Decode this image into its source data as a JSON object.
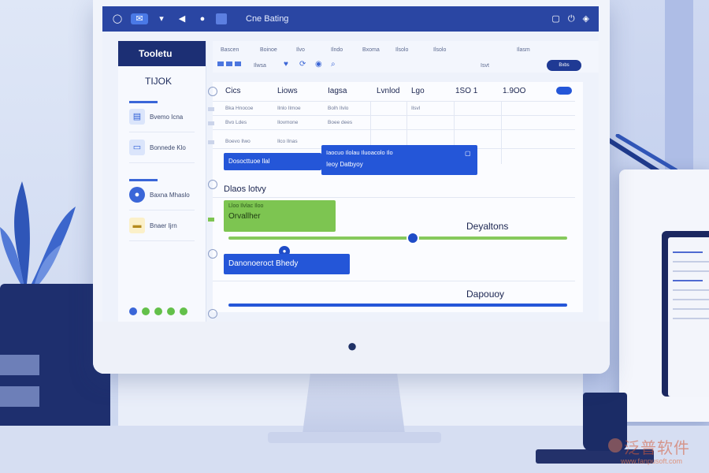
{
  "titlebar": {
    "app_title": "Cne Bating",
    "icons": [
      "ring-icon",
      "message-icon",
      "chevron-down-icon",
      "play-icon",
      "dot-icon",
      "square-icon"
    ],
    "right_icons": [
      "window-icon",
      "power-icon",
      "shield-icon"
    ]
  },
  "sidebar": {
    "header": "Tooletu",
    "subtitle": "TIJOK",
    "items": [
      {
        "label": "Bvemo Icna",
        "icon": "doc-icon"
      },
      {
        "label": "Bonnede Klo",
        "icon": "inbox-icon"
      },
      {
        "label": "Baxna Mhaslo",
        "icon": "user-circle-icon"
      },
      {
        "label": "Bnaer Ijrn",
        "icon": "card-icon"
      }
    ],
    "status_dots": 5
  },
  "toolbar": {
    "labels": [
      "Bascen",
      "Boinoe",
      "Ilvo",
      "Ilndo",
      "Bxoma",
      "Ilsolo",
      "Ilsolo",
      "Ilasm"
    ],
    "tiny_labels": [
      "Ilwsa",
      "Isvt"
    ],
    "action_button": "Bxbs"
  },
  "table": {
    "headers": [
      "Cics",
      "Liows",
      "Iagsa",
      "Lvnlod",
      "Lgo",
      "1SO 1",
      "1.9OO"
    ],
    "rows": [
      [
        "Bka Hnocoe",
        "Ilnlo Ilmoe",
        "Bolh Ilvlo",
        "",
        "Ilsvl",
        "",
        ""
      ],
      [
        "Bvo Ldes",
        "Ilovmone",
        "Boee dees",
        "",
        "",
        "",
        ""
      ],
      [
        "Boevo Ilwo",
        "Ilco Ilnas",
        "",
        "",
        "",
        "",
        ""
      ]
    ],
    "bar_task_1": "Dosocttuoe llal",
    "bar_task_2_line1": "Iaocuo Ilolau Iluoacolo Ilo",
    "bar_task_2_line2": "Ieoy Datbyoy",
    "section_label": "Dlaos lotvy",
    "green_task_line1": "Lloo Ilvlac Iloo",
    "green_task_line2": "Orvallher",
    "right_label_1": "Deyaltons",
    "blue_task": "Danonoeroct Bhedy",
    "right_label_2": "Dapouoy"
  },
  "watermark": {
    "brand": "泛普软件",
    "url": "www.fanpusoft.com"
  },
  "colors": {
    "accent_blue": "#2456d8",
    "accent_green": "#7dc551",
    "navy": "#1c2f74"
  }
}
